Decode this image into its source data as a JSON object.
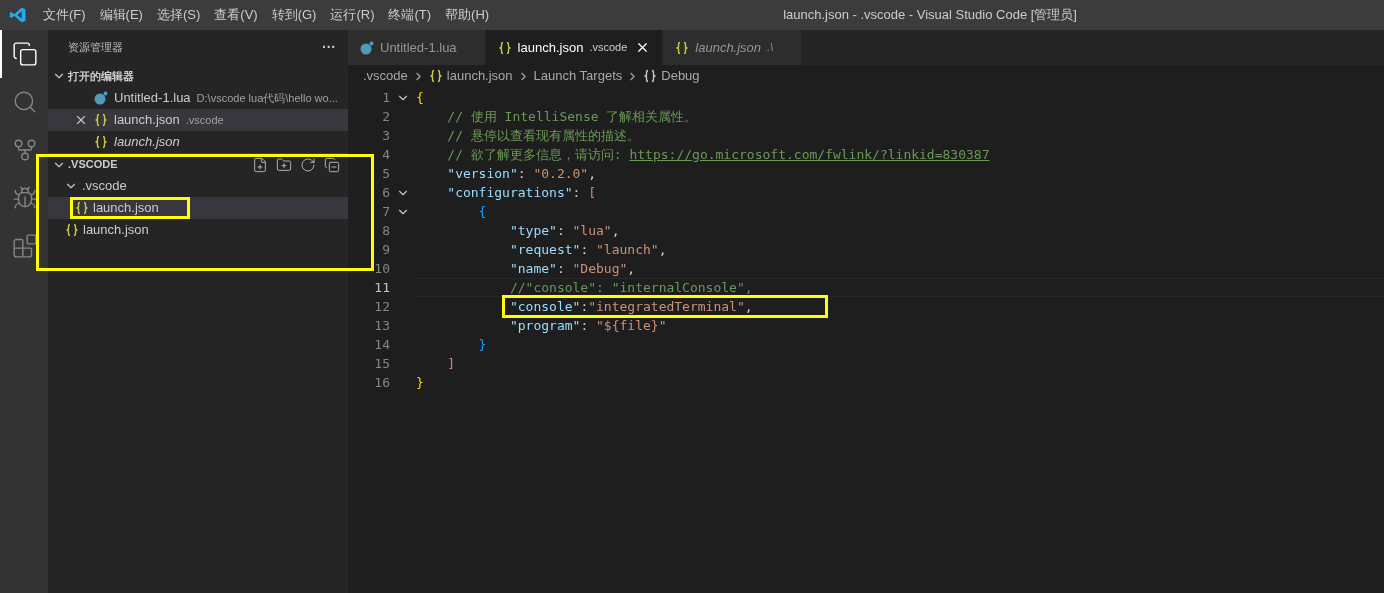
{
  "title_bar": {
    "menu": [
      "文件(F)",
      "编辑(E)",
      "选择(S)",
      "查看(V)",
      "转到(G)",
      "运行(R)",
      "终端(T)",
      "帮助(H)"
    ],
    "title": "launch.json - .vscode - Visual Studio Code [管理员]"
  },
  "activity_bar": [
    {
      "kind": "files",
      "selected": true
    },
    {
      "kind": "search",
      "selected": false
    },
    {
      "kind": "scm",
      "selected": false
    },
    {
      "kind": "debug",
      "selected": false
    },
    {
      "kind": "extensions",
      "selected": false
    }
  ],
  "sidebar": {
    "title": "资源管理器",
    "more": "···",
    "open_editors": {
      "title": "打开的编辑器",
      "expanded": true,
      "items": [
        {
          "kind": "lua",
          "label": "Untitled-1.lua",
          "description": "D:\\vscode lua代码\\hello wo...",
          "italic": false,
          "selected": false,
          "close": false
        },
        {
          "kind": "json",
          "label": "launch.json",
          "description": ".vscode",
          "italic": false,
          "selected": true,
          "close": true
        },
        {
          "kind": "json",
          "label": "launch.json",
          "italic": true,
          "selected": false,
          "close": false
        }
      ]
    },
    "folder": {
      "title": ".VSCODE",
      "expanded": true,
      "highlighted": true,
      "tree": [
        {
          "kind": "folder",
          "label": ".vscode",
          "expanded": true,
          "children": [
            {
              "kind": "json",
              "label": "launch.json",
              "selected": true,
              "highlighted": true
            }
          ]
        },
        {
          "kind": "json",
          "label": "launch.json",
          "selected": false,
          "highlighted": false
        }
      ]
    }
  },
  "tabs": [
    {
      "kind": "lua",
      "label": "Untitled-1.lua",
      "selected": false,
      "italic": false,
      "close": false
    },
    {
      "kind": "json",
      "label": "launch.json",
      "description": ".vscode",
      "selected": true,
      "italic": false,
      "close": true
    },
    {
      "kind": "json",
      "label": "launch.json",
      "description": ".\\",
      "selected": false,
      "italic": true,
      "close": false
    }
  ],
  "breadcrumbs": [
    {
      "kind": "folder",
      "label": ".vscode"
    },
    {
      "kind": "json",
      "label": "launch.json"
    },
    {
      "kind": "folder",
      "label": "Launch Targets"
    },
    {
      "kind": "object",
      "label": "Debug"
    }
  ],
  "code": [
    {
      "number": "1",
      "fold": true,
      "current": false,
      "boxed": false,
      "tokens": [
        {
          "kind": "brace1",
          "text": "{"
        }
      ]
    },
    {
      "number": "2",
      "fold": false,
      "current": false,
      "boxed": false,
      "tokens": [
        {
          "kind": "comment",
          "text": "    // 使用 IntelliSense 了解相关属性。"
        }
      ]
    },
    {
      "number": "3",
      "fold": false,
      "current": false,
      "boxed": false,
      "tokens": [
        {
          "kind": "comment",
          "text": "    // 悬停以查看现有属性的描述。"
        }
      ]
    },
    {
      "number": "4",
      "fold": false,
      "current": false,
      "boxed": false,
      "tokens": [
        {
          "kind": "comment",
          "text": "    // 欲了解更多信息，请访问: "
        },
        {
          "kind": "link",
          "text": "https://go.microsoft.com/fwlink/?linkid=830387"
        }
      ]
    },
    {
      "number": "5",
      "fold": false,
      "current": false,
      "boxed": false,
      "tokens": [
        {
          "kind": "key",
          "text": "    \"version\""
        },
        {
          "kind": "punct",
          "text": ": "
        },
        {
          "kind": "string",
          "text": "\"0.2.0\""
        },
        {
          "kind": "punct",
          "text": ","
        }
      ]
    },
    {
      "number": "6",
      "fold": true,
      "current": false,
      "boxed": false,
      "tokens": [
        {
          "kind": "key",
          "text": "    \"configurations\""
        },
        {
          "kind": "punct",
          "text": ": "
        },
        {
          "kind": "bracket",
          "text": "["
        }
      ]
    },
    {
      "number": "7",
      "fold": true,
      "current": false,
      "boxed": false,
      "tokens": [
        {
          "kind": "brace2",
          "text": "        {"
        }
      ]
    },
    {
      "number": "8",
      "fold": false,
      "current": false,
      "boxed": false,
      "tokens": [
        {
          "kind": "key",
          "text": "            \"type\""
        },
        {
          "kind": "punct",
          "text": ": "
        },
        {
          "kind": "string",
          "text": "\"lua\""
        },
        {
          "kind": "punct",
          "text": ","
        }
      ]
    },
    {
      "number": "9",
      "fold": false,
      "current": false,
      "boxed": false,
      "tokens": [
        {
          "kind": "key",
          "text": "            \"request\""
        },
        {
          "kind": "punct",
          "text": ": "
        },
        {
          "kind": "string",
          "text": "\"launch\""
        },
        {
          "kind": "punct",
          "text": ","
        }
      ]
    },
    {
      "number": "10",
      "fold": false,
      "current": false,
      "boxed": false,
      "tokens": [
        {
          "kind": "key",
          "text": "            \"name\""
        },
        {
          "kind": "punct",
          "text": ": "
        },
        {
          "kind": "string",
          "text": "\"Debug\""
        },
        {
          "kind": "punct",
          "text": ","
        }
      ]
    },
    {
      "number": "11",
      "fold": false,
      "current": true,
      "boxed": false,
      "tokens": [
        {
          "kind": "comment",
          "text": "            //\"console\": \"internalConsole\","
        }
      ]
    },
    {
      "number": "12",
      "fold": false,
      "current": false,
      "boxed": true,
      "tokens": [
        {
          "kind": "key",
          "text": "            \"console\""
        },
        {
          "kind": "punct",
          "text": ":"
        },
        {
          "kind": "string",
          "text": "\"integratedTerminal\""
        },
        {
          "kind": "punct",
          "text": ","
        }
      ]
    },
    {
      "number": "13",
      "fold": false,
      "current": false,
      "boxed": false,
      "tokens": [
        {
          "kind": "key",
          "text": "            \"program\""
        },
        {
          "kind": "punct",
          "text": ": "
        },
        {
          "kind": "string",
          "text": "\"${file}\""
        }
      ]
    },
    {
      "number": "14",
      "fold": false,
      "current": false,
      "boxed": false,
      "tokens": [
        {
          "kind": "brace2",
          "text": "        }"
        }
      ]
    },
    {
      "number": "15",
      "fold": false,
      "current": false,
      "boxed": false,
      "tokens": [
        {
          "kind": "bracket",
          "text": "    ]"
        }
      ]
    },
    {
      "number": "16",
      "fold": false,
      "current": false,
      "boxed": false,
      "tokens": [
        {
          "kind": "brace1",
          "text": "}"
        }
      ]
    }
  ]
}
